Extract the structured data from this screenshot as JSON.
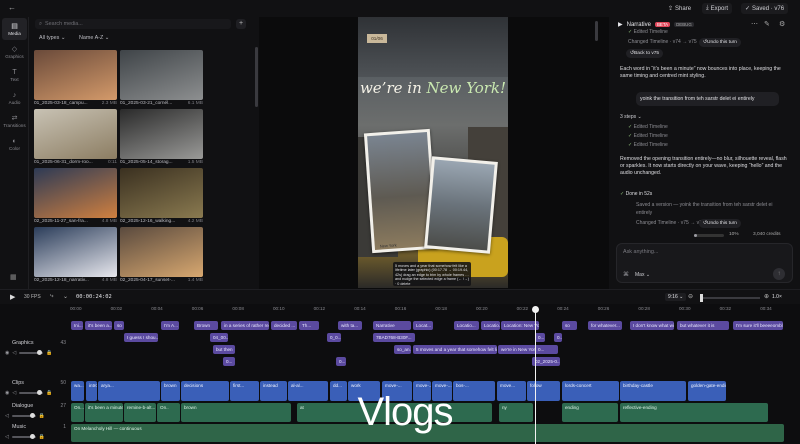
{
  "topbar": {
    "share": "Share",
    "export": "Export",
    "saved": "Saved · v76"
  },
  "rail": {
    "items": [
      "Media",
      "Graphics",
      "Text",
      "Audio",
      "Transitions",
      "Color"
    ]
  },
  "media": {
    "search_placeholder": "Search media...",
    "filter_type": "All types",
    "filter_sort": "Name A-Z",
    "items": [
      {
        "name": "01_2025-03-18_campu...",
        "size": "2.3 MB",
        "c1": "#6a4a3a",
        "c2": "#d49a6a"
      },
      {
        "name": "01_2025-03-21_cornél...",
        "size": "6.1 MB",
        "c1": "#3f4448",
        "c2": "#8d8f90"
      },
      {
        "name": "01_2025-06-31_dorm-roo...",
        "size": "0:11",
        "c1": "#c8c2b4",
        "c2": "#8c7d62"
      },
      {
        "name": "01_2025-05-14_storag...",
        "size": "1.5 MB",
        "c1": "#2a2a2a",
        "c2": "#9a9a98"
      },
      {
        "name": "02_2025-11-27_san-fra...",
        "size": "4.8 MB",
        "c1": "#2d3a55",
        "c2": "#d08040"
      },
      {
        "name": "02_2025-12-16_walking...",
        "size": "4.2 MB",
        "c1": "#3a3020",
        "c2": "#8a7a50"
      },
      {
        "name": "02_2025-12-18_narrativ...",
        "size": "4.8 MB",
        "c1": "#2b3d5a",
        "c2": "#e8e8ee"
      },
      {
        "name": "02_2025-04-17_sunset-...",
        "size": "1.4 MB",
        "c1": "#5a4a3e",
        "c2": "#d8a870"
      }
    ]
  },
  "preview": {
    "badge": "01/06",
    "title_a": "we’re in ",
    "title_b": "New York!",
    "photo_label": "New York",
    "caption": "5 moves and a year that somehow felt like a lifetime later (graphic) (00:17.78 → 00:19.44, 42s) drag an edge to trim by whole frames … and nudge the selected edge a frame (← /→) · 0 delete"
  },
  "chat": {
    "agent": "Narrative",
    "beta": "BETA",
    "tag": "DEBUG",
    "edited_top": "Edited Timeline",
    "changed_1": "Changed Timeline · v74 → v75",
    "undo": "Undo this turn",
    "back": "Back to v75",
    "para1": "Each word in “it’s been a minute” now bounces into place, keeping the same timing and centred mint styling.",
    "user_msg": "yoink the transition from teh sarstr delet ei entirely",
    "steps": "3 steps",
    "step_items": [
      "Edited Timeline",
      "Edited Timeline",
      "Edited Timeline"
    ],
    "para2": "Removed the opening transition entirely—no blur, silhouette reveal, flash or sparkles. It now starts directly on your wave, keeping “hello” and the audio unchanged.",
    "done": "Done in 52s",
    "saved_version": "Saved a version — yoink the transition from teh sarstr delet ei entirely",
    "changed_2": "Changed Timeline · v75 → v76",
    "undo2": "Undo this turn",
    "usage_pct": "10%",
    "usage_credits": "3,040 credits",
    "ask_placeholder": "Ask anything...",
    "model": "Max"
  },
  "timeline": {
    "fps": "30 FPS",
    "timecode": "00:00:24:02",
    "aspect": "9:16",
    "zoom": "1.0×",
    "ticks": [
      "00:00",
      "00:02",
      "00:04",
      "00:06",
      "00:08",
      "00:10",
      "00:12",
      "00:14",
      "00:16",
      "00:18",
      "00:20",
      "00:22",
      "00:24",
      "00:26",
      "00:28",
      "00:30",
      "00:32",
      "00:34"
    ],
    "tracks": {
      "graphics": {
        "label": "Graphics",
        "count": "43"
      },
      "clips": {
        "label": "Clips",
        "count": "50"
      },
      "dialogue": {
        "label": "Dialogue",
        "count": "27"
      },
      "music": {
        "label": "Music",
        "count": "1"
      }
    },
    "gfx_row1": [
      "Ini...",
      "it's been a...",
      "so",
      "I'm A...",
      "Brown",
      "in a series of rather rea...",
      "decided ...",
      "Th...",
      "with ta...",
      "Narrative",
      "Locat...",
      "Locatio...",
      "Locatio...",
      "Location: New York",
      "so",
      "for whatever...",
      "I don't know what wil...",
      "but whatever it is",
      "I'm sure it'll beeeeomblin..."
    ],
    "gfx_row2": [
      "I guess I shou...",
      "04_00...",
      "0_0...",
      "7BAD768-B30F...",
      "0...",
      "0..."
    ],
    "gfx_row3": [
      "but then",
      "so_an...",
      "5 moves and a year that somehow felt like ...",
      "we're in New York",
      "0..."
    ],
    "gfx_row4": [
      "0...",
      "0...",
      "02_2025-0..."
    ],
    "clip_row": [
      "wa...",
      "intro-memory",
      "arya...",
      "brown",
      "decisions",
      "first...",
      "instead",
      "al-al...",
      "dd...",
      "work",
      "move-...",
      "move-...",
      "move-...",
      "bos-...",
      "move...",
      "follow",
      "lords-concert",
      "birthday-castle",
      "golden-gate-ending"
    ],
    "dlg_row": [
      "On...",
      "it's been a minute",
      "remine-b-alt...",
      "On..",
      "brown",
      "at",
      "ny",
      "ending",
      "reflective-ending"
    ],
    "music_clip": "On Melancholy Hill — continuous",
    "overlay": "Vlogs"
  }
}
